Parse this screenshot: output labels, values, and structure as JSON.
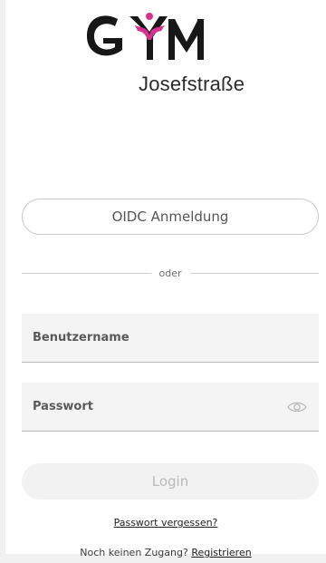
{
  "brand": {
    "logo_text": "GYM",
    "subtitle": "Josefstraße",
    "accent_color": "#d7328f"
  },
  "login": {
    "oidc_button_label": "OIDC Anmeldung",
    "divider_text": "oder",
    "username_label": "Benutzername",
    "password_label": "Passwort",
    "login_button_label": "Login",
    "forgot_password_link": "Passwort vergessen?",
    "register_prompt": "Noch keinen Zugang?",
    "register_link": "Registrieren"
  },
  "icons": {
    "password_toggle": "eye-icon"
  }
}
